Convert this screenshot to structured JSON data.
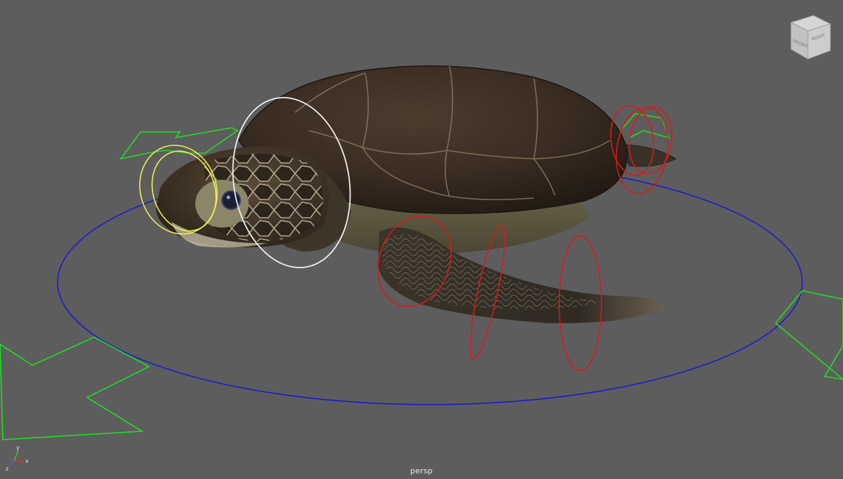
{
  "viewport": {
    "camera_label": "persp",
    "background_color": "#5d5d5d"
  },
  "view_cube": {
    "front_label": "FRONT",
    "side_label": "RIGHT"
  },
  "axis_gizmo": {
    "y_label": "y",
    "x_label": "x",
    "z_label": "z"
  },
  "colors": {
    "ground_circle": "#1c1ccc",
    "foot_control": "#22dd22",
    "head_control": "#f0f0f0",
    "neck_control": "#eeee55",
    "limb_control": "#d81a1a"
  }
}
